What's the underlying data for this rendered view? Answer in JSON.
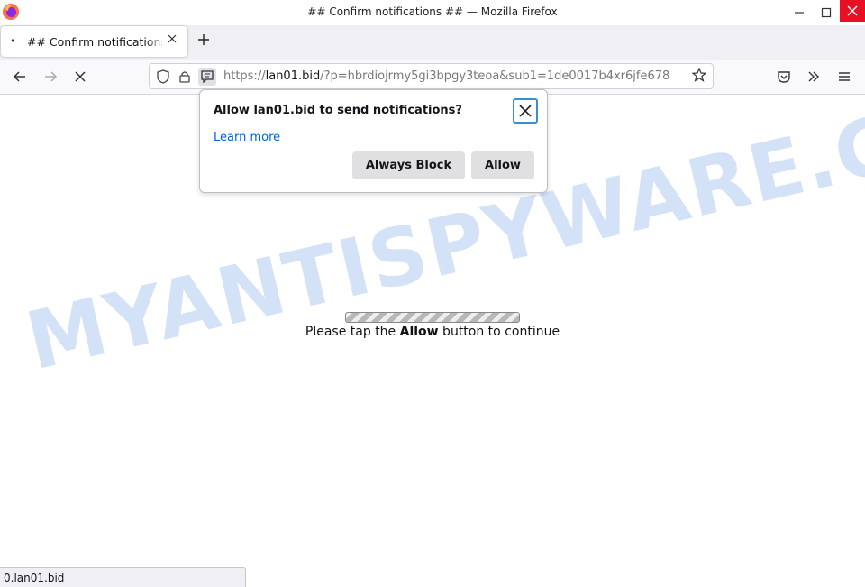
{
  "window": {
    "title": "## Confirm notifications ## — Mozilla Firefox",
    "minimize_icon": "minimize-icon",
    "maximize_icon": "maximize-icon",
    "close_icon": "close-icon"
  },
  "tab": {
    "title": "## Confirm notifications",
    "close_icon": "close-icon",
    "new_tab_icon": "plus-icon"
  },
  "navbar": {
    "back_icon": "arrow-left-icon",
    "forward_icon": "arrow-right-icon",
    "stop_icon": "stop-icon",
    "url_prefix": "https://",
    "url_domain": "lan01.bid",
    "url_rest": "/?p=hbrdiojrmy5gi3bpgy3teoa&sub1=1de0017b4xr6jfe678",
    "pocket_icon": "pocket-icon",
    "overflow_icon": "chevron-double-right-icon",
    "menu_icon": "hamburger-icon"
  },
  "popup": {
    "title": "Allow lan01.bid to send notifications?",
    "learn_more": "Learn more",
    "block_label": "Always Block",
    "allow_label": "Allow"
  },
  "page": {
    "message_before": "Please tap the ",
    "message_bold": "Allow",
    "message_after": " button to continue",
    "watermark": "MYANTISPYWARE.COM"
  },
  "status": {
    "text": "0.lan01.bid"
  }
}
